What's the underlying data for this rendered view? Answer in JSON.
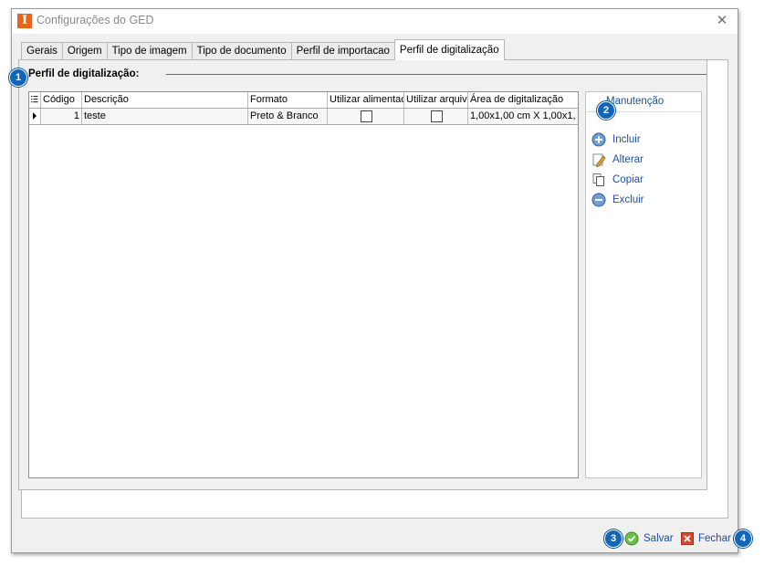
{
  "window": {
    "title": "Configurações do GED",
    "close_glyph": "✕"
  },
  "tabs": [
    {
      "label": "Gerais"
    },
    {
      "label": "Origem"
    },
    {
      "label": "Tipo de imagem"
    },
    {
      "label": "Tipo de documento"
    },
    {
      "label": "Perfil de importacao"
    },
    {
      "label": "Perfil de digitalização",
      "active": true
    }
  ],
  "group": {
    "title": "Perfil de digitalização:"
  },
  "grid": {
    "columns": [
      "Código",
      "Descrição",
      "Formato",
      "Utilizar alimentac",
      "Utilizar arquiv",
      "Área de digitalização"
    ],
    "rows": [
      {
        "codigo": "1",
        "descricao": "teste",
        "formato": "Preto & Branco",
        "alimentador": false,
        "arquivo": false,
        "area": "1,00x1,00 cm X 1,00x1,"
      }
    ]
  },
  "side": {
    "title": "Manutenção",
    "items": [
      {
        "label": "Incluir",
        "icon": "plus-circle-icon"
      },
      {
        "label": "Alterar",
        "icon": "pencil-icon"
      },
      {
        "label": "Copiar",
        "icon": "copy-icon"
      },
      {
        "label": "Excluir",
        "icon": "minus-circle-icon"
      }
    ]
  },
  "footer": {
    "save_label": "Salvar",
    "close_label": "Fechar"
  },
  "badges": [
    "1",
    "2",
    "3",
    "4"
  ],
  "colors": {
    "accent": "#1265b8",
    "link": "#1e4fa0",
    "app_icon": "#e8641b",
    "save_icon": "#6cc04a",
    "close_icon": "#d9472b"
  }
}
